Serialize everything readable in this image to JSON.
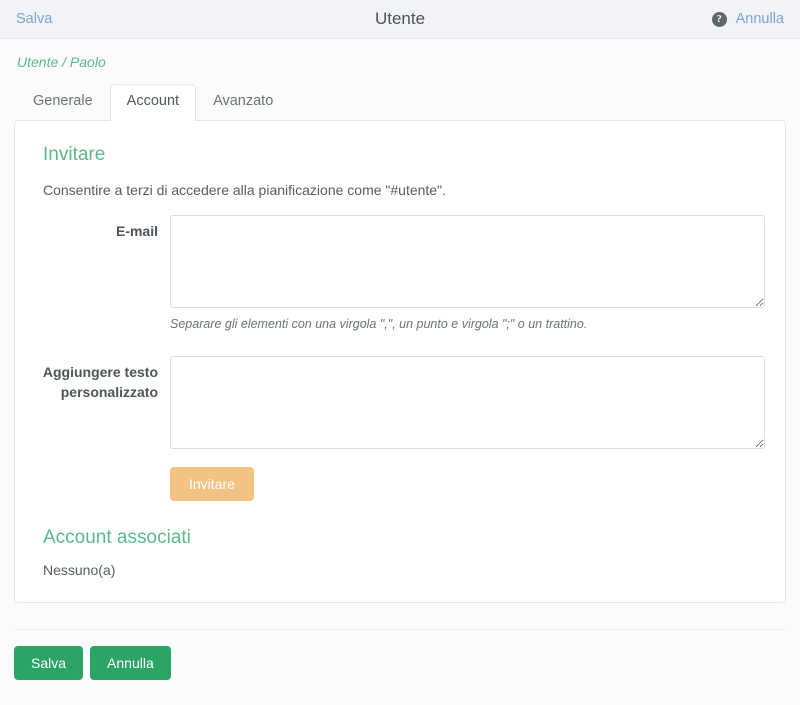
{
  "topbar": {
    "save_label": "Salva",
    "title": "Utente",
    "help_icon": "question-mark-circle-icon",
    "help_glyph": "?",
    "cancel_label": "Annulla"
  },
  "breadcrumb": "Utente / Paolo",
  "tabs": [
    {
      "label": "Generale",
      "active": false
    },
    {
      "label": "Account",
      "active": true
    },
    {
      "label": "Avanzato",
      "active": false
    }
  ],
  "invite_section": {
    "title": "Invitare",
    "description": "Consentire a terzi di accedere alla pianificazione come \"#utente\".",
    "email": {
      "label": "E-mail",
      "value": "",
      "placeholder": "",
      "help": "Separare gli elementi con una virgola \",\", un punto e virgola \";\" o un trattino."
    },
    "custom_text": {
      "label": "Aggiungere testo personalizzato",
      "value": "",
      "placeholder": ""
    },
    "invite_button": "Invitare"
  },
  "associated_section": {
    "title": "Account associati",
    "empty_text": "Nessuno(a)"
  },
  "footer": {
    "save_label": "Salva",
    "cancel_label": "Annulla"
  },
  "colors": {
    "accent_green": "#5cb98a",
    "button_green": "#2ba565",
    "button_orange": "#f3c383",
    "link_blue": "#7aa6d6",
    "topbar_bg": "#f1f3f6",
    "page_bg": "#fbfbfc"
  }
}
